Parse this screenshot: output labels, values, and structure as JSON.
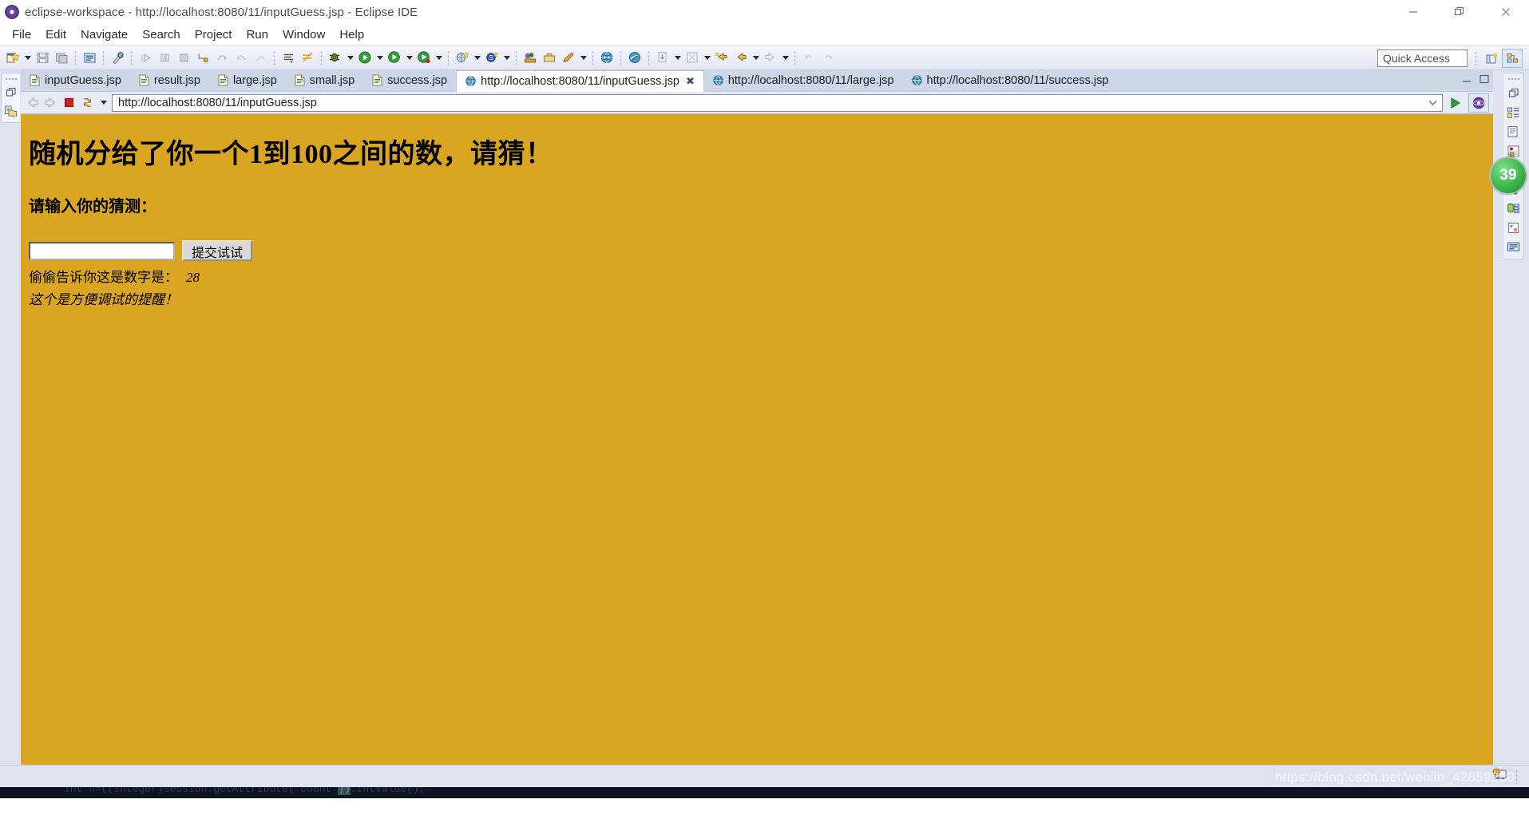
{
  "window": {
    "title": "eclipse-workspace - http://localhost:8080/11/inputGuess.jsp - Eclipse IDE",
    "app_icon": "eclipse-gear-icon",
    "controls": {
      "minimize": "minimize-icon",
      "restore": "restore-icon",
      "close": "close-icon"
    }
  },
  "menu": {
    "items": [
      {
        "label": "File"
      },
      {
        "label": "Edit"
      },
      {
        "label": "Navigate"
      },
      {
        "label": "Search"
      },
      {
        "label": "Project"
      },
      {
        "label": "Run"
      },
      {
        "label": "Window"
      },
      {
        "label": "Help"
      }
    ]
  },
  "toolbar": {
    "quick_access_placeholder": "Quick Access",
    "quick_access_value": "",
    "buttons": [
      {
        "name": "new-wizard-icon",
        "dropdown": true
      },
      {
        "name": "save-icon",
        "dropdown": false
      },
      {
        "name": "save-all-icon",
        "dropdown": false
      },
      {
        "name": "print-icon",
        "dropdown": false
      },
      {
        "name": "quick-fix-icon",
        "dropdown": false
      },
      {
        "name": "resume-icon",
        "dropdown": false
      },
      {
        "name": "suspend-icon",
        "dropdown": false
      },
      {
        "name": "terminate-icon",
        "dropdown": false
      },
      {
        "name": "disconnect-icon",
        "dropdown": false
      },
      {
        "name": "step-into-icon",
        "dropdown": false
      },
      {
        "name": "step-over-icon",
        "dropdown": false
      },
      {
        "name": "step-return-icon",
        "dropdown": false
      },
      {
        "name": "open-task-icon",
        "dropdown": false
      },
      {
        "name": "skip-breakpoints-icon",
        "dropdown": false
      },
      {
        "name": "debug-icon",
        "dropdown": true
      },
      {
        "name": "run-icon",
        "dropdown": true
      },
      {
        "name": "run-server-icon",
        "dropdown": true
      },
      {
        "name": "profile-icon",
        "dropdown": true
      },
      {
        "name": "new-java-class-icon",
        "dropdown": true
      },
      {
        "name": "search-icon",
        "dropdown": false
      },
      {
        "name": "open-type-icon",
        "dropdown": false
      },
      {
        "name": "new-package-icon",
        "dropdown": false
      },
      {
        "name": "edit-icon",
        "dropdown": true
      },
      {
        "name": "web-browser-icon",
        "dropdown": false
      },
      {
        "name": "run-on-server-icon",
        "dropdown": false
      },
      {
        "name": "download-icon",
        "dropdown": true
      },
      {
        "name": "annotation-icon",
        "dropdown": true
      },
      {
        "name": "back-history-icon",
        "dropdown": false
      },
      {
        "name": "back-arrow-icon",
        "dropdown": true
      },
      {
        "name": "forward-arrow-icon",
        "dropdown": true
      },
      {
        "name": "previous-edit-icon",
        "dropdown": false
      },
      {
        "name": "next-edit-icon",
        "dropdown": false
      }
    ],
    "perspective_new": "open-perspective-icon",
    "perspective_current": "java-ee-perspective-icon"
  },
  "editor_tabs": [
    {
      "label": "inputGuess.jsp",
      "icon": "jsp-file-icon",
      "active": false,
      "closable": false
    },
    {
      "label": "result.jsp",
      "icon": "jsp-file-icon",
      "active": false,
      "closable": false
    },
    {
      "label": "large.jsp",
      "icon": "jsp-file-icon",
      "active": false,
      "closable": false
    },
    {
      "label": "small.jsp",
      "icon": "jsp-file-icon",
      "active": false,
      "closable": false
    },
    {
      "label": "success.jsp",
      "icon": "jsp-file-icon",
      "active": false,
      "closable": false
    },
    {
      "label": "http://localhost:8080/11/inputGuess.jsp",
      "icon": "globe-icon",
      "active": true,
      "closable": true
    },
    {
      "label": "http://localhost:8080/11/large.jsp",
      "icon": "globe-icon",
      "active": false,
      "closable": false
    },
    {
      "label": "http://localhost:8080/11/success.jsp",
      "icon": "globe-icon",
      "active": false,
      "closable": false
    }
  ],
  "tab_close_glyph": "✖",
  "browser": {
    "back": "back-icon",
    "forward": "forward-icon",
    "stop": "stop-icon",
    "refresh": "refresh-icon",
    "refresh_dropdown": "chevron-down-icon",
    "url": "http://localhost:8080/11/inputGuess.jsp",
    "url_placeholder": "Enter URL",
    "combo_caret": "chevron-down-icon",
    "go": "go-icon",
    "open_external": "open-external-browser-icon"
  },
  "page": {
    "bg_color": "#DAA520",
    "heading": "随机分给了你一个1到100之间的数，请猜！",
    "subheading": "请输入你的猜测：",
    "input_value": "",
    "input_placeholder": "",
    "submit_label": "提交试试",
    "hint_label": "偷偷告诉你这是数字是：",
    "hint_number": "28",
    "debug_note": "这个是方便调试的提醒！"
  },
  "left_rail": {
    "items": [
      {
        "name": "restore-view-icon"
      },
      {
        "name": "project-explorer-icon"
      }
    ]
  },
  "right_rail": {
    "items": [
      {
        "name": "restore-view-icon"
      },
      {
        "name": "outline-view-icon"
      },
      {
        "name": "task-list-icon"
      },
      {
        "name": "markers-view-icon"
      },
      {
        "name": "properties-view-icon"
      },
      {
        "name": "servers-view-icon"
      },
      {
        "name": "data-source-explorer-icon"
      },
      {
        "name": "snippets-view-icon"
      },
      {
        "name": "console-view-icon"
      }
    ],
    "badge": {
      "value": "39",
      "color": "#3cb54a"
    }
  },
  "statusbar": {
    "server_icon": "server-status-icon",
    "tip_icon": "tip-lightbulb-icon",
    "watermark": "https://blog.csdn.net/weixin_42859280"
  },
  "desktop_strip": {
    "code_text_before": "int n=((Integer)session.getAttribute(\"count\"",
    "code_text_selected": "))",
    "code_text_after": ".intValue();"
  }
}
